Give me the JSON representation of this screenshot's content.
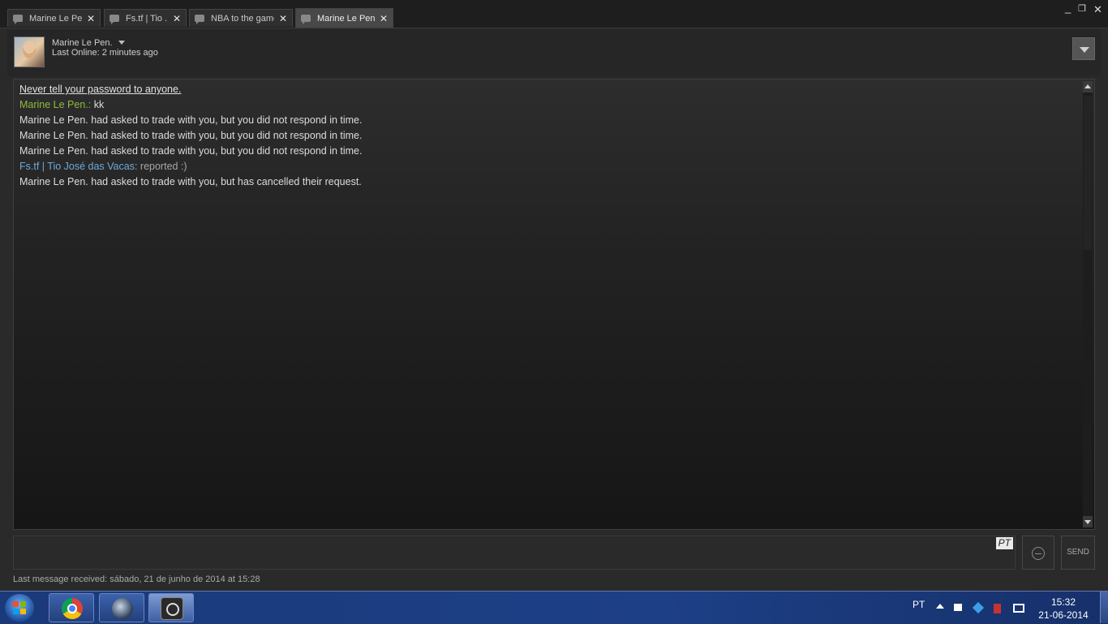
{
  "tabs": [
    {
      "label": "Marine Le Pen",
      "active": false
    },
    {
      "label": "Fs.tf | Tio ...",
      "active": false
    },
    {
      "label": "NBA to the game",
      "active": false
    },
    {
      "label": "Marine Le Pen.",
      "active": true
    }
  ],
  "window": {
    "minimize": "_",
    "restore": "❐",
    "close": "✕"
  },
  "header": {
    "name": "Marine Le Pen.",
    "last_online": "Last Online: 2 minutes ago"
  },
  "chat": {
    "warning": "Never tell your password to anyone.",
    "messages": [
      {
        "sender": "Marine Le Pen.:",
        "text": " kk"
      },
      {
        "system": "Marine Le Pen. had asked to trade with you, but you did not respond in time."
      },
      {
        "system": "Marine Le Pen. had asked to trade with you, but you did not respond in time."
      },
      {
        "system": "Marine Le Pen. had asked to trade with you, but you did not respond in time."
      },
      {
        "sender": "Fs.tf | Tio José das Vacas",
        "text": ": reported :)"
      },
      {
        "system": "Marine Le Pen. had asked to trade with you, but has cancelled their request."
      }
    ]
  },
  "input": {
    "lang_badge": "PT",
    "send_label": "SEND"
  },
  "status": "Last message received: sábado, 21 de junho de 2014 at 15:28",
  "taskbar": {
    "tray_lang": "PT",
    "time": "15:32",
    "date": "21-06-2014"
  }
}
